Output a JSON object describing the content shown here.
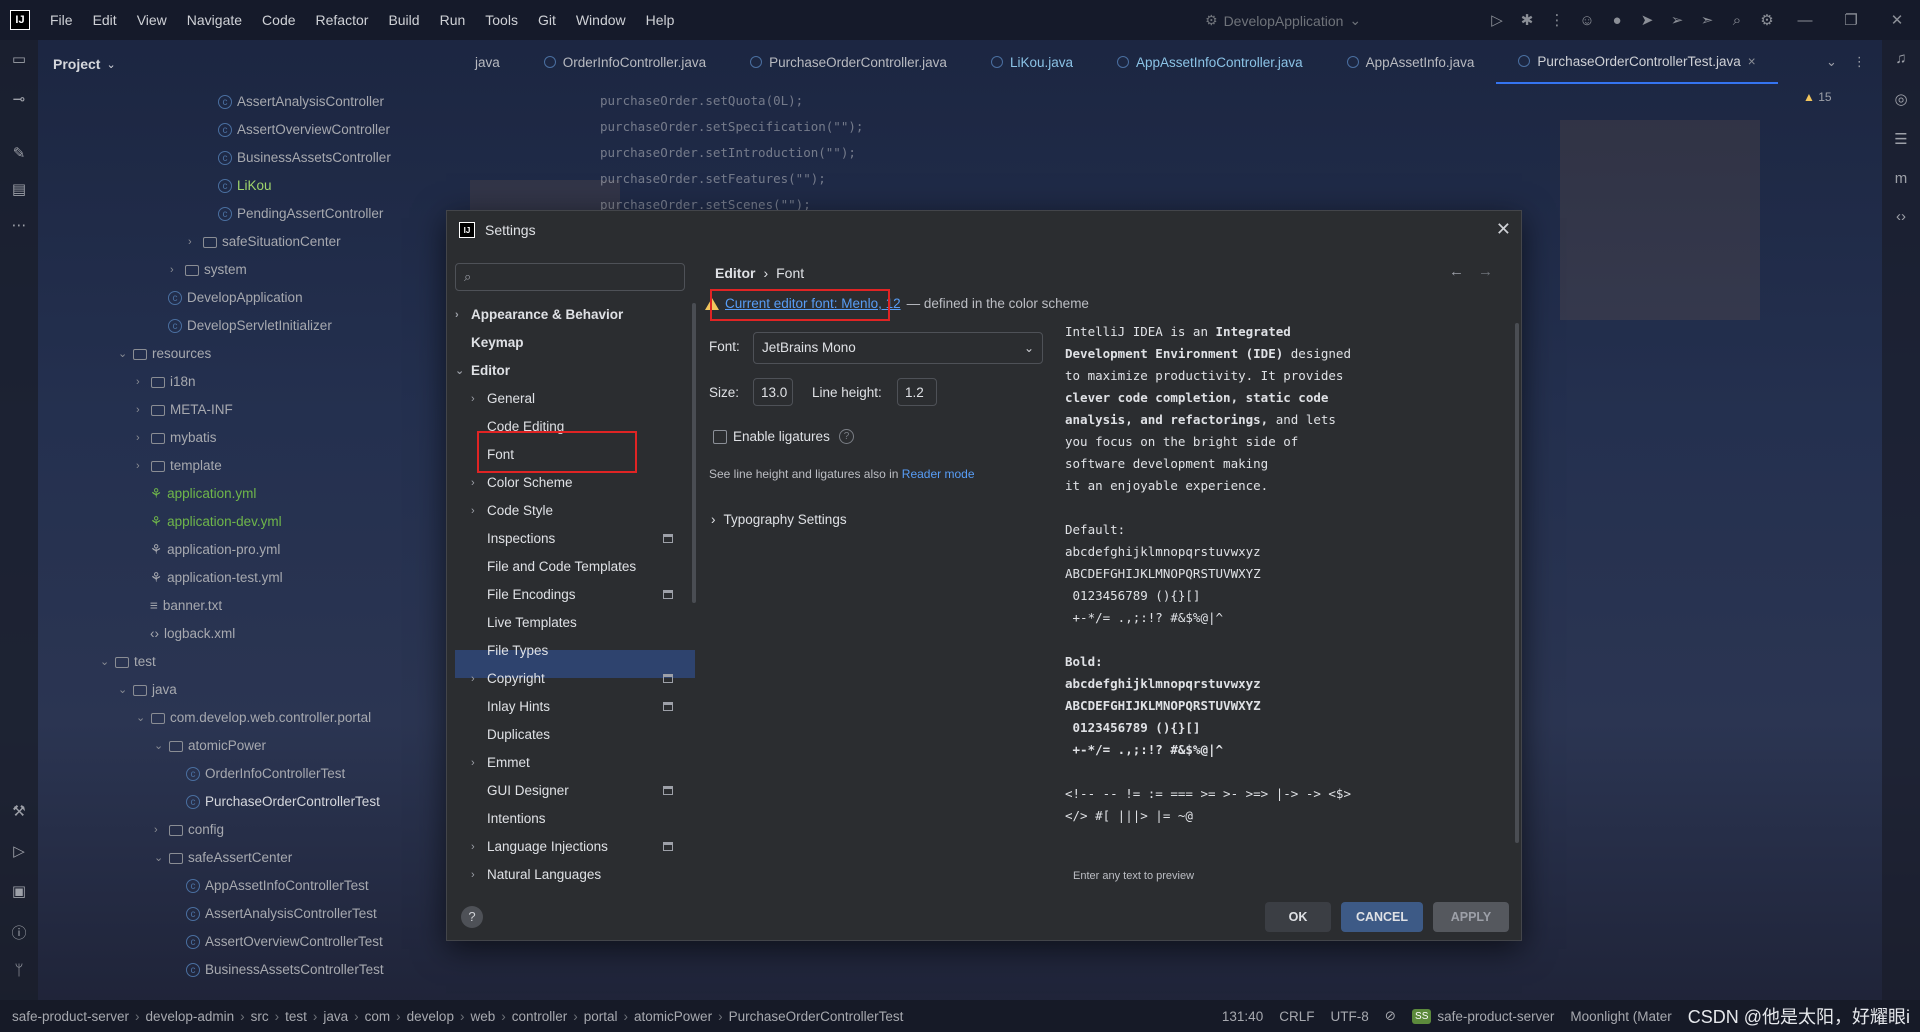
{
  "menubar": {
    "logo": "IJ",
    "items": [
      "File",
      "Edit",
      "View",
      "Navigate",
      "Code",
      "Refactor",
      "Build",
      "Run",
      "Tools",
      "Git",
      "Window",
      "Help"
    ],
    "run_config": "DevelopApplication"
  },
  "project": {
    "header": "Project",
    "tree": [
      {
        "label": "AssertAnalysisController",
        "kind": "class"
      },
      {
        "label": "AssertOverviewController",
        "kind": "class"
      },
      {
        "label": "BusinessAssetsController",
        "kind": "class"
      },
      {
        "label": "LiKou",
        "kind": "class-hl"
      },
      {
        "label": "PendingAssertController",
        "kind": "class"
      },
      {
        "label": "safeSituationCenter",
        "kind": "folder"
      },
      {
        "label": "system",
        "kind": "folder"
      },
      {
        "label": "DevelopApplication",
        "kind": "class"
      },
      {
        "label": "DevelopServletInitializer",
        "kind": "class"
      },
      {
        "label": "resources",
        "kind": "folder-open"
      },
      {
        "label": "i18n",
        "kind": "folder"
      },
      {
        "label": "META-INF",
        "kind": "folder"
      },
      {
        "label": "mybatis",
        "kind": "folder"
      },
      {
        "label": "template",
        "kind": "folder"
      },
      {
        "label": "application.yml",
        "kind": "yml"
      },
      {
        "label": "application-dev.yml",
        "kind": "yml"
      },
      {
        "label": "application-pro.yml",
        "kind": "file"
      },
      {
        "label": "application-test.yml",
        "kind": "file"
      },
      {
        "label": "banner.txt",
        "kind": "file"
      },
      {
        "label": "logback.xml",
        "kind": "file"
      },
      {
        "label": "test",
        "kind": "folder-open"
      },
      {
        "label": "java",
        "kind": "folder-open"
      },
      {
        "label": "com.develop.web.controller.portal",
        "kind": "folder-open"
      },
      {
        "label": "atomicPower",
        "kind": "folder-open"
      },
      {
        "label": "OrderInfoControllerTest",
        "kind": "class"
      },
      {
        "label": "PurchaseOrderControllerTest",
        "kind": "class-active"
      },
      {
        "label": "config",
        "kind": "folder"
      },
      {
        "label": "safeAssertCenter",
        "kind": "folder-open"
      },
      {
        "label": "AppAssetInfoControllerTest",
        "kind": "class"
      },
      {
        "label": "AssertAnalysisControllerTest",
        "kind": "class"
      },
      {
        "label": "AssertOverviewControllerTest",
        "kind": "class"
      },
      {
        "label": "BusinessAssetsControllerTest",
        "kind": "class"
      }
    ]
  },
  "tabs": [
    {
      "label": "java",
      "active": false
    },
    {
      "label": "OrderInfoController.java",
      "active": false
    },
    {
      "label": "PurchaseOrderController.java",
      "active": false
    },
    {
      "label": "LiKou.java",
      "active": false
    },
    {
      "label": "AppAssetInfoController.java",
      "active": false
    },
    {
      "label": "AppAssetInfo.java",
      "active": false
    },
    {
      "label": "PurchaseOrderControllerTest.java",
      "active": true
    }
  ],
  "warning_count": "15",
  "code_lines": [
    "purchaseOrder.setQuota(0L);",
    "purchaseOrder.setSpecification(\"\");",
    "purchaseOrder.setIntroduction(\"\");",
    "purchaseOrder.setFeatures(\"\");",
    "purchaseOrder.setScenes(\"\");"
  ],
  "statusbar": {
    "breadcrumbs": [
      "safe-product-server",
      "develop-admin",
      "src",
      "test",
      "java",
      "com",
      "develop",
      "web",
      "controller",
      "portal",
      "atomicPower",
      "PurchaseOrderControllerTest"
    ],
    "position": "131:40",
    "line_sep": "CRLF",
    "encoding": "UTF-8",
    "ss_badge": "SS",
    "project": "safe-product-server",
    "theme": "Moonlight (Mater",
    "watermark": "CSDN @他是太阳，好耀眼i"
  },
  "settings": {
    "title": "Settings",
    "search_placeholder": "",
    "nav": [
      {
        "label": "Appearance & Behavior",
        "level": 0,
        "arrow": "›",
        "bold": true,
        "badge": false
      },
      {
        "label": "Keymap",
        "level": 0,
        "arrow": "",
        "bold": true,
        "badge": false
      },
      {
        "label": "Editor",
        "level": 0,
        "arrow": "⌄",
        "bold": true,
        "badge": false
      },
      {
        "label": "General",
        "level": 1,
        "arrow": "›",
        "bold": false,
        "badge": false
      },
      {
        "label": "Code Editing",
        "level": 1,
        "arrow": "",
        "bold": false,
        "badge": false
      },
      {
        "label": "Font",
        "level": 1,
        "arrow": "",
        "bold": false,
        "badge": false,
        "selected": true
      },
      {
        "label": "Color Scheme",
        "level": 1,
        "arrow": "›",
        "bold": false,
        "badge": false
      },
      {
        "label": "Code Style",
        "level": 1,
        "arrow": "›",
        "bold": false,
        "badge": false
      },
      {
        "label": "Inspections",
        "level": 1,
        "arrow": "",
        "bold": false,
        "badge": true
      },
      {
        "label": "File and Code Templates",
        "level": 1,
        "arrow": "",
        "bold": false,
        "badge": false
      },
      {
        "label": "File Encodings",
        "level": 1,
        "arrow": "",
        "bold": false,
        "badge": true
      },
      {
        "label": "Live Templates",
        "level": 1,
        "arrow": "",
        "bold": false,
        "badge": false
      },
      {
        "label": "File Types",
        "level": 1,
        "arrow": "",
        "bold": false,
        "badge": false
      },
      {
        "label": "Copyright",
        "level": 1,
        "arrow": "›",
        "bold": false,
        "badge": true
      },
      {
        "label": "Inlay Hints",
        "level": 1,
        "arrow": "",
        "bold": false,
        "badge": true
      },
      {
        "label": "Duplicates",
        "level": 1,
        "arrow": "",
        "bold": false,
        "badge": false
      },
      {
        "label": "Emmet",
        "level": 1,
        "arrow": "›",
        "bold": false,
        "badge": false
      },
      {
        "label": "GUI Designer",
        "level": 1,
        "arrow": "",
        "bold": false,
        "badge": true
      },
      {
        "label": "Intentions",
        "level": 1,
        "arrow": "",
        "bold": false,
        "badge": false
      },
      {
        "label": "Language Injections",
        "level": 1,
        "arrow": "›",
        "bold": false,
        "badge": true
      },
      {
        "label": "Natural Languages",
        "level": 1,
        "arrow": "›",
        "bold": false,
        "badge": false
      }
    ],
    "breadcrumb": {
      "parent": "Editor",
      "sep": "›",
      "current": "Font"
    },
    "warning_link": "Current editor font: Menlo, 12",
    "warning_suffix": "— defined in the color scheme",
    "font_label": "Font:",
    "font_value": "JetBrains Mono",
    "size_label": "Size:",
    "size_value": "13.0",
    "line_height_label": "Line height:",
    "line_height_value": "1.2",
    "ligatures_label": "Enable ligatures",
    "note_text": "See line height and ligatures also in ",
    "note_link": "Reader mode",
    "typography": "Typography Settings",
    "preview_hint": "Enter any text to preview",
    "ok": "OK",
    "cancel": "CANCEL",
    "apply": "APPLY",
    "help": "?"
  }
}
